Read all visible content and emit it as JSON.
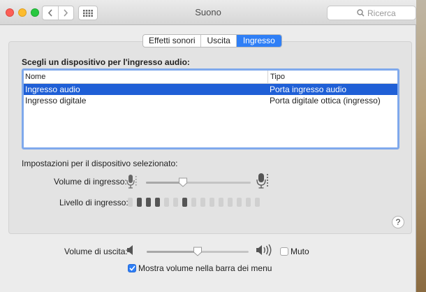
{
  "window": {
    "title": "Suono",
    "search_placeholder": "Ricerca"
  },
  "tabs": [
    {
      "label": "Effetti sonori",
      "active": false
    },
    {
      "label": "Uscita",
      "active": false
    },
    {
      "label": "Ingresso",
      "active": true
    }
  ],
  "input": {
    "heading": "Scegli un dispositivo per l'ingresso audio:",
    "columns": {
      "name": "Nome",
      "type": "Tipo"
    },
    "devices": [
      {
        "name": "Ingresso audio",
        "type": "Porta ingresso audio",
        "selected": true
      },
      {
        "name": "Ingresso digitale",
        "type": "Porta digitale ottica (ingresso)",
        "selected": false
      }
    ],
    "settings_label": "Impostazioni per il dispositivo selezionato:",
    "volume_label": "Volume di ingresso:",
    "volume_level": 0.35,
    "level_label": "Livello di ingresso:",
    "level_segments": 15,
    "level_active": [
      1,
      2,
      3,
      6
    ]
  },
  "output": {
    "volume_label": "Volume di uscita:",
    "volume_level": 0.5,
    "mute_label": "Muto",
    "mute_checked": false,
    "show_in_menu_label": "Mostra volume nella barra dei menu",
    "show_in_menu_checked": true
  },
  "help_label": "?",
  "colors": {
    "accent": "#2f7ff6",
    "selection": "#1f5fd6"
  }
}
